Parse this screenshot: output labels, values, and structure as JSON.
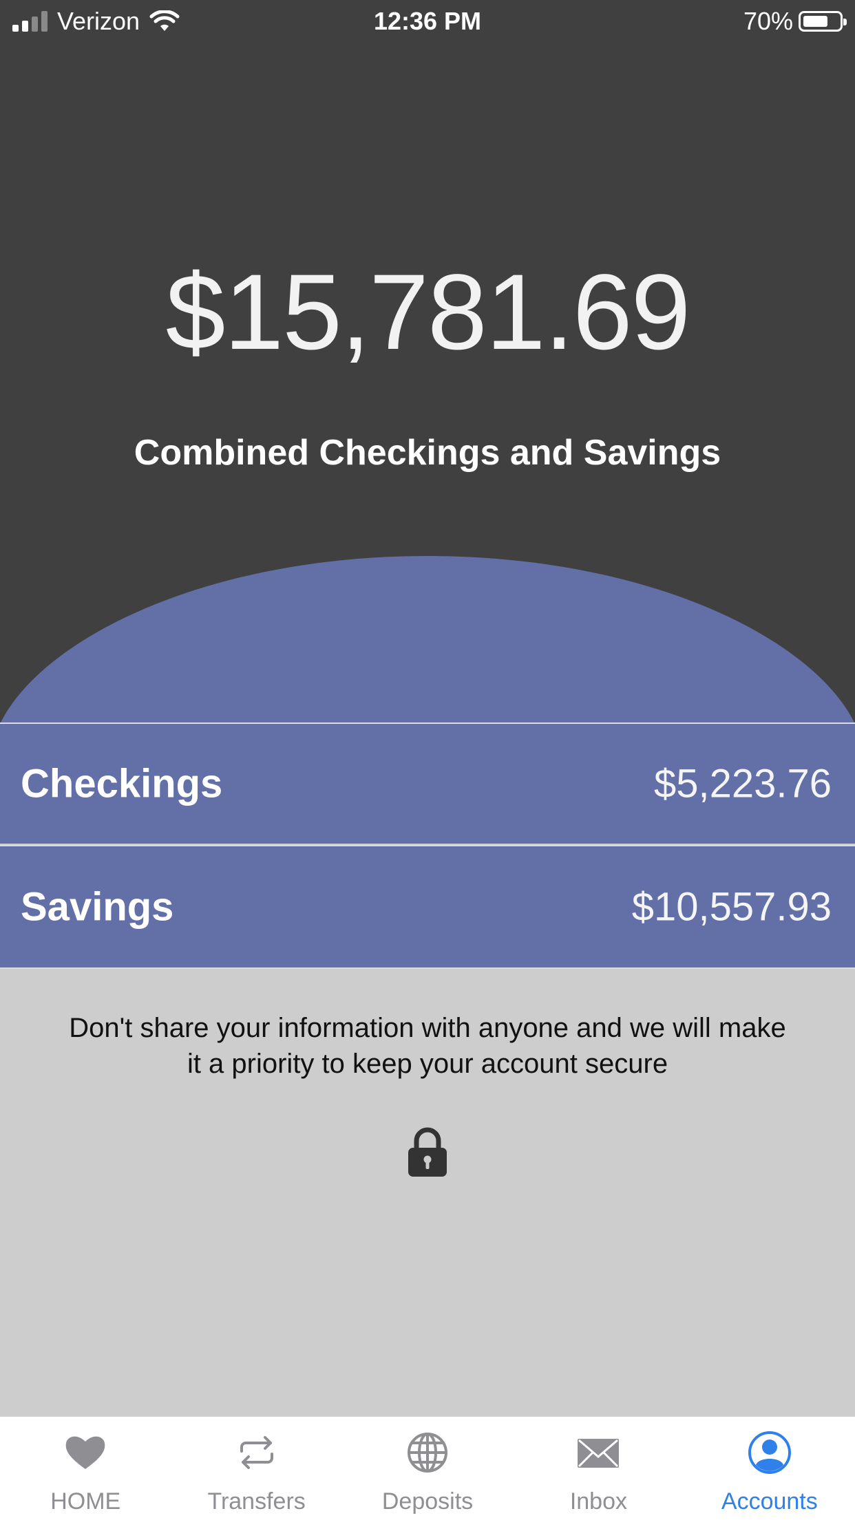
{
  "status_bar": {
    "carrier": "Verizon",
    "time": "12:36 PM",
    "battery_percent": "70%",
    "battery_level": 0.7,
    "signal_bars_active": 2,
    "signal_bars_total": 4
  },
  "summary": {
    "total": "$15,781.69",
    "label": "Combined Checkings and Savings"
  },
  "accounts": [
    {
      "name": "Checkings",
      "balance": "$5,223.76"
    },
    {
      "name": "Savings",
      "balance": "$10,557.93"
    }
  ],
  "notice": {
    "text": "Don't share your information with anyone and we will make it a priority to keep your account secure",
    "icon": "lock-icon"
  },
  "tabbar": {
    "items": [
      {
        "label": "HOME",
        "icon": "heart-icon",
        "active": false
      },
      {
        "label": "Transfers",
        "icon": "transfer-arrows-icon",
        "active": false
      },
      {
        "label": "Deposits",
        "icon": "globe-icon",
        "active": false
      },
      {
        "label": "Inbox",
        "icon": "envelope-icon",
        "active": false
      },
      {
        "label": "Accounts",
        "icon": "user-circle-icon",
        "active": true
      }
    ]
  },
  "colors": {
    "header_bg": "#404040",
    "accent_band": "#6270a7",
    "body_bg": "#cdcdcd",
    "tab_active": "#2f80e8",
    "tab_inactive": "#8e8e93"
  }
}
